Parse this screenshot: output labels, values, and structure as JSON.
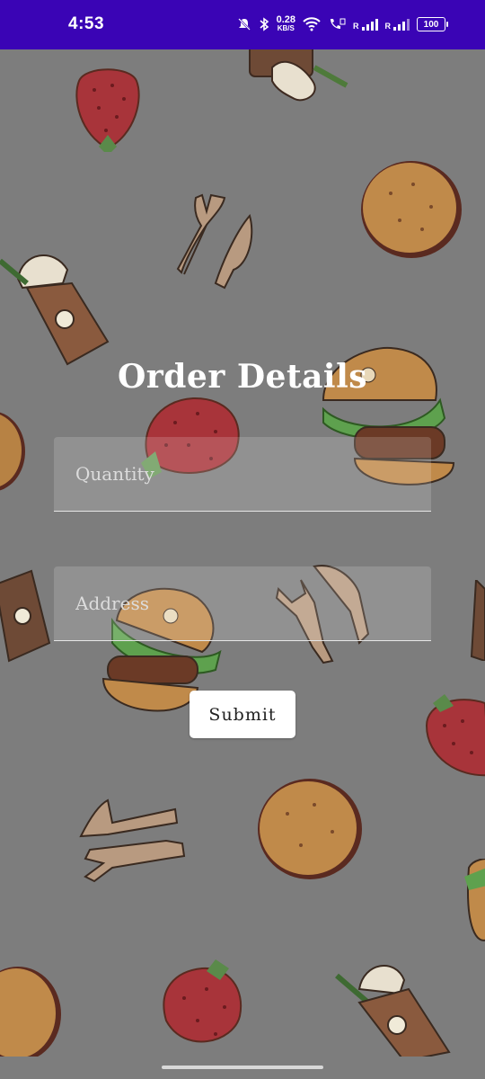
{
  "status_bar": {
    "time": "4:53",
    "net_speed_value": "0.28",
    "net_speed_unit": "KB/S",
    "sim1_label": "R",
    "sim2_label": "R",
    "battery": "100",
    "icons": [
      "mute-icon",
      "bluetooth-icon",
      "wifi-icon",
      "volte-call-icon",
      "signal-icon",
      "battery-icon"
    ],
    "background_color": "#3a04b5"
  },
  "form": {
    "title": "Order Details",
    "quantity": {
      "placeholder": "Quantity",
      "value": ""
    },
    "address": {
      "placeholder": "Address",
      "value": ""
    },
    "submit_label": "Submit"
  },
  "background": {
    "color": "#7d7d7d",
    "pattern": [
      "strawberry-icon",
      "frappe-cup-icon",
      "burger-icon",
      "bun-icon",
      "fork-knife-icon"
    ]
  }
}
